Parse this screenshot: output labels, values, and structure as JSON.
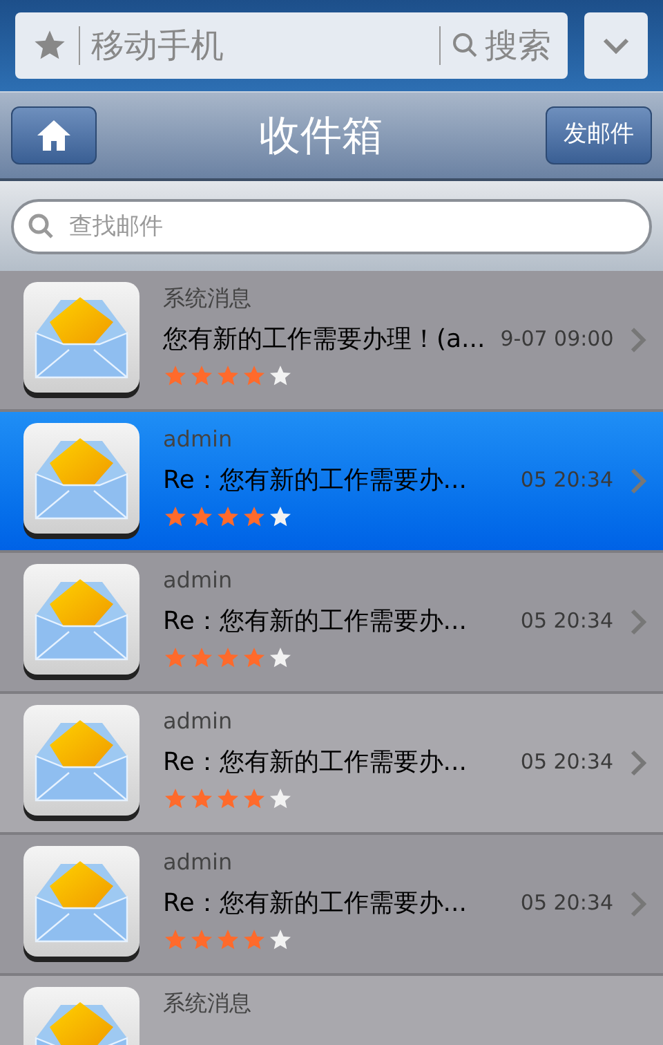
{
  "browser_bar": {
    "address": "移动手机",
    "search_label": "搜索"
  },
  "nav": {
    "title": "收件箱",
    "compose_button": "发邮件"
  },
  "search": {
    "placeholder": "查找邮件"
  },
  "messages": [
    {
      "sender": "系统消息",
      "subject": "您有新的工作需要办理！(a...",
      "time": "9-07 09:00",
      "stars": 4,
      "selected": false
    },
    {
      "sender": "admin",
      "subject": "Re：您有新的工作需要办...",
      "time": "05 20:34",
      "stars": 4,
      "selected": true
    },
    {
      "sender": "admin",
      "subject": "Re：您有新的工作需要办...",
      "time": "05 20:34",
      "stars": 4,
      "selected": false
    },
    {
      "sender": "admin",
      "subject": "Re：您有新的工作需要办...",
      "time": "05 20:34",
      "stars": 4,
      "selected": false
    },
    {
      "sender": "admin",
      "subject": "Re：您有新的工作需要办...",
      "time": "05 20:34",
      "stars": 4,
      "selected": false
    },
    {
      "sender": "系统消息",
      "selected": false
    }
  ]
}
